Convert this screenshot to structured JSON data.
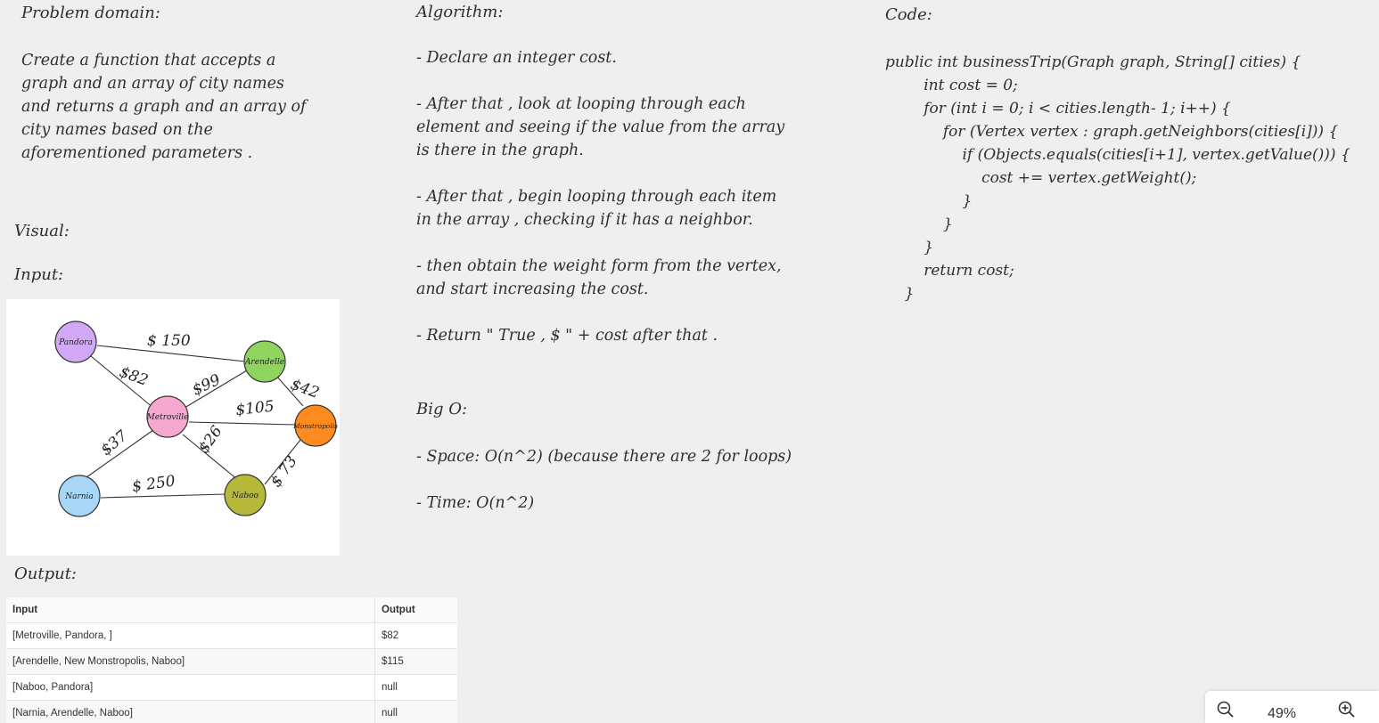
{
  "problem": {
    "heading": "Problem domain:",
    "text": "Create a function that accepts a\ngraph and an array of city names\nand returns a graph and an array of\ncity names based on the\naforementioned parameters ."
  },
  "visual_label": "Visual:",
  "input_label": "Input:",
  "graph": {
    "nodes": [
      {
        "label": "Pandora",
        "color": "#d0a8f5"
      },
      {
        "label": "Arendelle",
        "color": "#8fd45e"
      },
      {
        "label": "Metroville",
        "color": "#f7a8d0"
      },
      {
        "label": "Monstropolis",
        "color": "#ff8a1f"
      },
      {
        "label": "Narnia",
        "color": "#a8d6f7"
      },
      {
        "label": "Naboo",
        "color": "#b5b83a"
      }
    ],
    "edges": [
      {
        "label": "$ 150"
      },
      {
        "label": "$82"
      },
      {
        "label": "$99"
      },
      {
        "label": "$42"
      },
      {
        "label": "$105"
      },
      {
        "label": "$37"
      },
      {
        "label": "$26"
      },
      {
        "label": "$ 250"
      },
      {
        "label": "$ 73"
      }
    ]
  },
  "output_label": "Output:",
  "table": {
    "headers": [
      "Input",
      "Output"
    ],
    "rows": [
      [
        "[Metroville, Pandora, ]",
        "$82"
      ],
      [
        "[Arendelle, New Monstropolis, Naboo]",
        "$115"
      ],
      [
        "[Naboo, Pandora]",
        "null"
      ],
      [
        "[Narnia, Arendelle, Naboo]",
        "null"
      ]
    ]
  },
  "algorithm": {
    "heading": "Algorithm:",
    "steps": [
      "- Declare an integer cost.",
      "- After that , look at looping through each\nelement and seeing if the value from the array\nis there in the graph.",
      "- After that , begin looping through each item\nin the array , checking if it has a neighbor.",
      "- then obtain the weight form from the vertex,\nand start increasing the cost.",
      "-  Return \" True , $ \" + cost after that ."
    ]
  },
  "bigo": {
    "heading": "Big O:",
    "space": "- Space:  O(n^2)  (because there are 2 for loops)",
    "time": "- Time:  O(n^2)"
  },
  "code": {
    "heading": "Code:",
    "text": "public int businessTrip(Graph graph, String[] cities) {\n        int cost = 0;\n        for (int i = 0; i < cities.length- 1; i++) {\n            for (Vertex vertex : graph.getNeighbors(cities[i])) {\n                if (Objects.equals(cities[i+1], vertex.getValue())) {\n                    cost += vertex.getWeight();\n                }\n            }\n        }\n        return cost;\n    }"
  },
  "zoom": {
    "level": "49%",
    "zoom_out_icon": "zoom-out-icon",
    "zoom_in_icon": "zoom-in-icon"
  }
}
